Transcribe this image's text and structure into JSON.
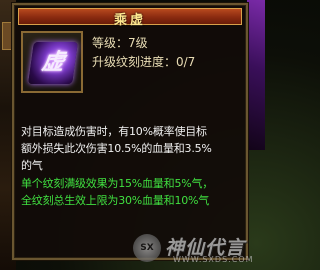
{
  "skill": {
    "name": "乘虚",
    "icon_glyph": "虚",
    "level_text": "等级：7级",
    "progress_text": "升级纹刻进度：0/7"
  },
  "description": {
    "lines": [
      "对目标造成伤害时，有10%概率使目标",
      "额外损失此次伤害10.5%的血量和3.5%",
      "的气"
    ],
    "bonus_lines": [
      "单个纹刻满级效果为15%血量和5%气，",
      "全纹刻总生效上限为30%血量和10%气"
    ]
  },
  "watermark": {
    "logo_text": "SX",
    "text": "神仙代言",
    "url": "WWW.SXDS.COM"
  },
  "colors": {
    "title_text": "#ffe890",
    "title_bar": "#8a2a10",
    "border_gold": "#8a6a34",
    "bonus_text_green": "#40e040",
    "icon_purple": "#7a3ac8"
  }
}
